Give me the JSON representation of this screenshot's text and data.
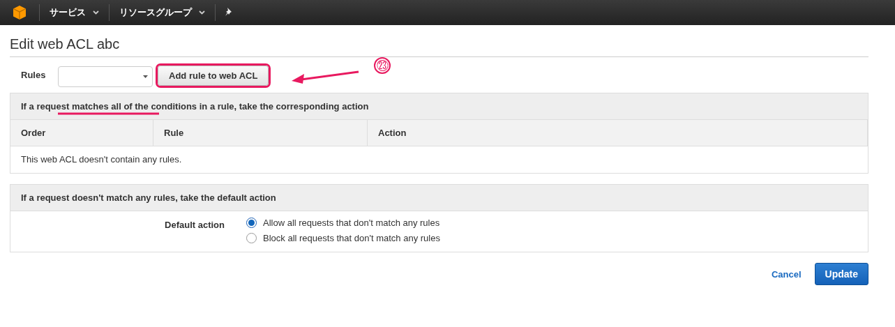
{
  "nav": {
    "items": [
      {
        "label": "サービス"
      },
      {
        "label": "リソースグループ"
      }
    ]
  },
  "title": "Edit web ACL abc",
  "rules": {
    "label": "Rules",
    "add_button": "Add rule to web ACL"
  },
  "annotation": {
    "marker": "㉓"
  },
  "rules_table": {
    "heading": "If a request matches all of the conditions in a rule, take the corresponding action",
    "columns": [
      "Order",
      "Rule",
      "Action"
    ],
    "empty": "This web ACL doesn't contain any rules."
  },
  "default_panel": {
    "heading": "If a request doesn't match any rules, take the default action",
    "label": "Default action",
    "options": [
      {
        "label": "Allow all requests that don't match any rules",
        "selected": true
      },
      {
        "label": "Block all requests that don't match any rules",
        "selected": false
      }
    ]
  },
  "buttons": {
    "cancel": "Cancel",
    "update": "Update"
  }
}
